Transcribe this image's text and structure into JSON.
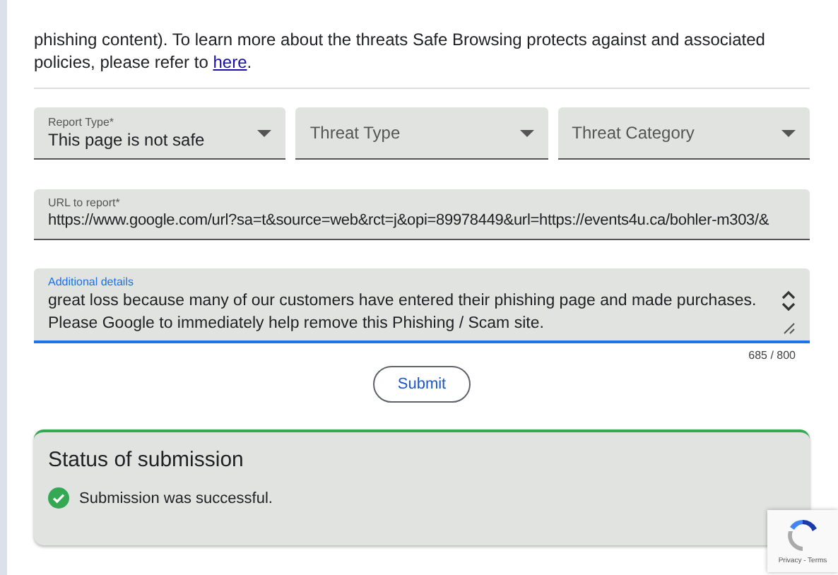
{
  "intro": {
    "text": "phishing content). To learn more about the threats Safe Browsing protects against and associated policies, please refer to ",
    "link": "here",
    "after": "."
  },
  "selects": [
    {
      "label": "Report Type*",
      "value": "This page is not safe"
    },
    {
      "placeholder": "Threat Type"
    },
    {
      "placeholder": "Threat Category"
    }
  ],
  "url_field": {
    "label": "URL to report*",
    "value": "https://www.google.com/url?sa=t&source=web&rct=j&opi=89978449&url=https://events4u.ca/bohler-m303/&"
  },
  "details_field": {
    "label": "Additional details",
    "value": "great loss because many of our customers have entered their phishing page and made purchases. Please Google to immediately help remove this Phishing / Scam site.",
    "counter": "685 / 800",
    "focused": true
  },
  "submit_button": "Submit",
  "status": {
    "title": "Status of submission",
    "message": "Submission was successful.",
    "success": true
  },
  "recaptcha": {
    "links": "Privacy - Terms"
  }
}
